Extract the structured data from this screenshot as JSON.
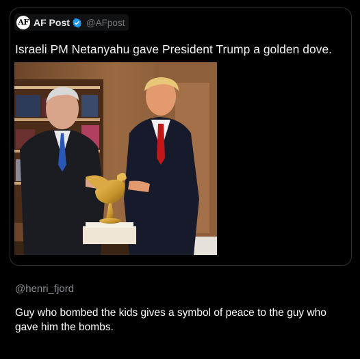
{
  "post": {
    "avatar_initials": "AF",
    "display_name": "AF Post",
    "handle": "@AFpost",
    "text": "Israeli PM Netanyahu gave President Trump a golden dove."
  },
  "photo": {
    "subject": "two men in suits standing beside a golden dove sculpture on a marble base in a wood-paneled room"
  },
  "reply": {
    "handle": "@henri_fjord",
    "text": "Guy who bombed the kids gives a symbol of peace to the guy who gave him the bombs."
  },
  "colors": {
    "background": "#000000",
    "verified_badge": "#1d9bf0",
    "secondary_text": "#71767b",
    "border": "#2f3336"
  }
}
